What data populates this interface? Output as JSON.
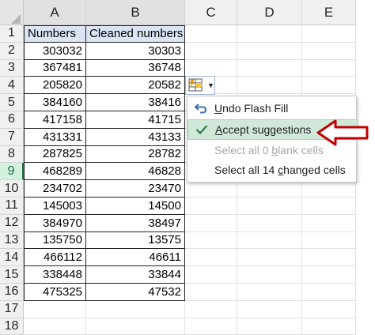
{
  "columns": [
    "A",
    "B",
    "C",
    "D",
    "E"
  ],
  "rows": [
    "1",
    "2",
    "3",
    "4",
    "5",
    "6",
    "7",
    "8",
    "9",
    "10",
    "11",
    "12",
    "13",
    "14",
    "15",
    "16",
    "17",
    "18"
  ],
  "table": {
    "headers": [
      "Numbers",
      "Cleaned numbers"
    ],
    "data": [
      [
        "303032",
        "30303"
      ],
      [
        "367481",
        "36748"
      ],
      [
        "205820",
        "20582"
      ],
      [
        "384160",
        "38416"
      ],
      [
        "417158",
        "41715"
      ],
      [
        "431331",
        "43133"
      ],
      [
        "287825",
        "28782"
      ],
      [
        "468289",
        "46828"
      ],
      [
        "234702",
        "23470"
      ],
      [
        "145003",
        "14500"
      ],
      [
        "384970",
        "38497"
      ],
      [
        "135750",
        "13575"
      ],
      [
        "466112",
        "46611"
      ],
      [
        "338448",
        "33844"
      ],
      [
        "475325",
        "47532"
      ]
    ]
  },
  "menu": {
    "undo": {
      "pre": "",
      "u": "U",
      "post": "ndo Flash Fill"
    },
    "accept": {
      "pre": "",
      "u": "A",
      "post": "ccept suggestions"
    },
    "select_blank": {
      "pre": "Select all 0 ",
      "u": "b",
      "post": "lank cells"
    },
    "select_changed": {
      "pre": "Select all 14 ",
      "u": "c",
      "post": "hanged cells"
    }
  },
  "colors": {
    "accent": "#217346",
    "header_fill": "#dae4f4",
    "highlight": "#cfe8d8",
    "arrow": "#c00000"
  },
  "icons": [
    "flash-fill-icon",
    "chevron-down-icon",
    "undo-icon",
    "check-icon",
    "arrow-left-icon"
  ]
}
